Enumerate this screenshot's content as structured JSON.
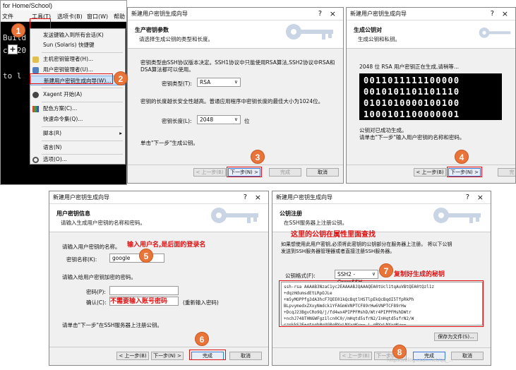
{
  "terminal": {
    "title": "for Home/School)",
    "menubar": [
      "文件",
      "工具(T)",
      "选项卡(B)",
      "窗口(W)",
      "帮助"
    ],
    "plus": "+",
    "lines": [
      "Build",
      "c) 20",
      "",
      "to l"
    ]
  },
  "menu": {
    "items": [
      "发送键输入到所有会话(K)",
      "Sun (Solaris) 快捷键",
      "主机密钥管理者(H)...",
      "用户密钥管理者(U)...",
      "新建用户密钥生成向导(W)...",
      "Xagent 开始(A)",
      "配色方案(C)...",
      "快速命令集(Q)...",
      "脚本(R)",
      "语言(N)",
      "选项(O)..."
    ]
  },
  "wizard_title": "新建用户密钥生成向导",
  "help_glyph": "?",
  "close_glyph": "×",
  "step1": {
    "header_title": "生产密钥参数",
    "header_sub": "请选择生成公钥的类型和长度。",
    "desc1": "密钥类型由SSH协议版本决定。SSH1协议中只能使用RSA算法,SSH2协议中RSA和",
    "desc1b": "DSA算法都可以使用。",
    "type_label": "密钥类型(T):",
    "type_value": "RSA",
    "desc2": "密钥的长度越长安全性越高。普通应用程序中密钥长度的最佳大小为1024位。",
    "len_label": "密钥长度(L):",
    "len_value": "2048",
    "len_unit": "位",
    "footer": "单击\"下一步\"生成公钥。",
    "btn_back": "< 上一步(B)",
    "btn_next": "下一步(N) >",
    "btn_finish": "完成",
    "btn_cancel": "取消"
  },
  "step2": {
    "header_title": "生成公钥对",
    "header_sub": "生成公钥和私钥。",
    "status": "2048 位 RSA 用户密钥正在生成,请稍等...",
    "binary": [
      "0011011111100000",
      "0010101101101110",
      "0101010000100100",
      "1000101100000001"
    ],
    "done1": "公钥对已成功生成。",
    "done2": "请单击\"下一步\"输入用户密钥的名称和密码。",
    "btn_back": "< 上一步(B)",
    "btn_next": "下一步(N) >",
    "btn_finish": "完"
  },
  "step3": {
    "header_title": "用户密钥信息",
    "header_sub": "请输入生成用户密钥的名称和密码。",
    "p1": "请输入用户密钥的名称。",
    "anno_name": "输入用户名,是后面的登录名",
    "name_label": "密钥名称(K):",
    "name_value": "google",
    "p2": "请输入给用户密钥加密的密码。",
    "pwd_label": "密码(P):",
    "confirm_label": "确认(C):",
    "anno_pwd": "不需要输入账号密码",
    "confirm_hint": "(重新输入密码)",
    "footer": "请单击\"下一步\"在SSH服务器上注册公钥。",
    "btn_back": "< 上一步(B)",
    "btn_next": "下一步(N) >",
    "btn_finish": "完成",
    "btn_cancel": "取消"
  },
  "step4": {
    "header_title": "公钥注册",
    "header_sub": "在SSH服务器上注册公钥。",
    "anno_title": "这里的公钥在属性里面查找",
    "p1": "如果想使用此用户密钥,必须将此密钥的公钥部分在服务器上注册。 将以下公钥",
    "p1b": "发送到SSH服务器管理器或者直接注册SSH服务器。",
    "fmt_label": "公钥格式(F):",
    "fmt_value": "SSH2 - OpenSSH",
    "anno_copy": "复制好生成的秘钥",
    "key_text": "ssh-rsa AAAAB3NzaC1yc2EAAAABJQAAAQEA0tUcl1tqAuVBtQEA0tQzl1z\n+dqzHdumsdEtLRpOJLe\n+m5yMOPPfg3dA3hcF7QEE01kQcBqtlHSTlpEkQcBqdI5TfpRkPh\nBLpvymedxZXxyNmdck1YFAGm6VNPTCF89rHw6VNPTCF89rHw\n+DcqJ23BgvCRo9Q/j/fd4wx4PIPPFMshD/Wtr4PIPPFMshDWtr\n+nchJ748THNGWFgz1lcn0C0//mHqtd5sfrN2/InHqtd5sfrN2/W\nczpkkS2E+qtpgbPoUGRgPYxLNXxgKw== L gPYxLNXxgKw==",
    "btn_save": "保存为文件(S)...",
    "btn_back": "< 上一步(B)",
    "btn_next": "下一步(N) >",
    "btn_finish": "完成",
    "btn_cancel": "取消"
  },
  "steps": [
    "1",
    "2",
    "3",
    "4",
    "5",
    "6",
    "7",
    "8"
  ],
  "watermark": "https://blog.csdn.net/qq_..."
}
